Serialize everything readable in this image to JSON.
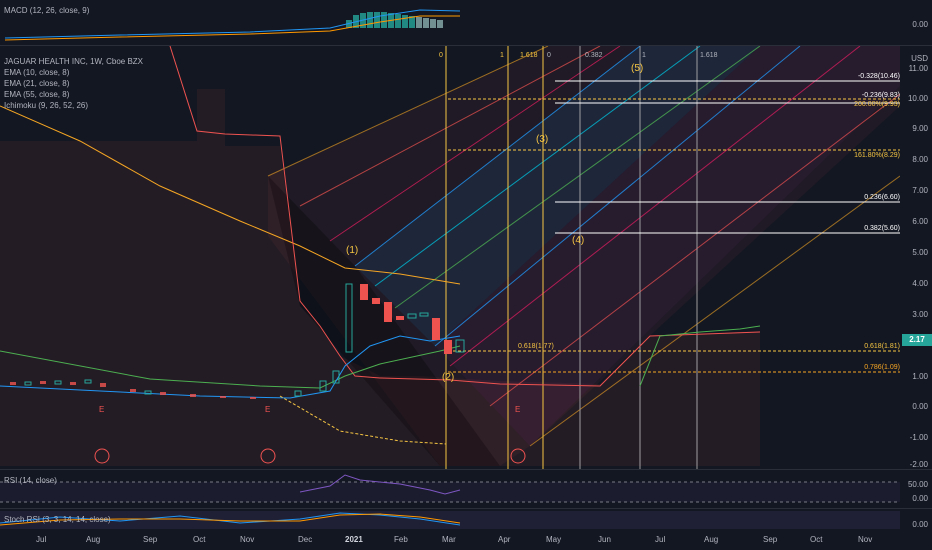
{
  "macd": {
    "legend": "MACD (12, 26, close, 9)",
    "zero": "0.00"
  },
  "main": {
    "title": "JAGUAR HEALTH INC, 1W, Cboe BZX",
    "indicators": [
      "EMA (10, close, 8)",
      "EMA (21, close, 8)",
      "EMA (55, close, 8)",
      "Ichimoku (9, 26, 52, 26)"
    ],
    "currency": "USD",
    "price_axis": [
      "11.00",
      "10.00",
      "9.00",
      "8.00",
      "7.00",
      "6.00",
      "5.00",
      "4.00",
      "3.00",
      "1.00",
      "0.00",
      "-1.00",
      "-2.00"
    ],
    "last_price": "2.17",
    "fib_top": [
      "0",
      "1",
      "1.618",
      "0",
      "0.382",
      "1",
      "1.618"
    ],
    "fib_levels": [
      {
        "text": "-0.328(10.46)",
        "color": "#ffffff"
      },
      {
        "text": "-0.236(9.83)",
        "color": "#ffffff"
      },
      {
        "text": "200.00%(9.93)",
        "color": "#f5c542"
      },
      {
        "text": "161.80%(8.29)",
        "color": "#f5c542"
      },
      {
        "text": "0.236(6.60)",
        "color": "#ffffff"
      },
      {
        "text": "0.382(5.60)",
        "color": "#ffffff"
      },
      {
        "text": "0.618(1.81)",
        "color": "#f5c542"
      },
      {
        "text": "0.786(1.09)",
        "color": "#f5a623"
      }
    ],
    "fib_left_label": "0.618(1.77)",
    "waves": [
      "(1)",
      "(2)",
      "(3)",
      "(4)",
      "(5)"
    ],
    "event_marker": "E"
  },
  "rsi": {
    "legend": "RSI (14, close)",
    "ticks": [
      "50.00",
      "0.00"
    ]
  },
  "stoch": {
    "legend": "Stoch RSI (3, 3, 14, 14, close)",
    "ticks": [
      "0.00"
    ]
  },
  "time_axis": [
    "Jul",
    "Aug",
    "Sep",
    "Oct",
    "Nov",
    "Dec",
    "2021",
    "Feb",
    "Mar",
    "Apr",
    "May",
    "Jun",
    "Jul",
    "Aug",
    "Sep",
    "Oct",
    "Nov"
  ],
  "colors": {
    "bg": "#131722",
    "up": "#26a69a",
    "down": "#ef5350",
    "fib": "#f5c542",
    "ema_orange": "#f5a623",
    "ema_blue": "#2196f3",
    "ema_green": "#4caf50"
  },
  "chart_data": {
    "type": "candlestick",
    "title": "JAGUAR HEALTH INC, 1W, Cboe BZX",
    "ylim": [
      -2,
      11
    ],
    "candles": [
      {
        "x": "2021-01-04",
        "o": 1.0,
        "c": 4.0
      },
      {
        "x": "2021-01-11",
        "o": 4.0,
        "c": 3.2
      },
      {
        "x": "2021-01-18",
        "o": 3.2,
        "c": 3.0
      },
      {
        "x": "2021-01-25",
        "o": 3.0,
        "c": 2.3
      },
      {
        "x": "2021-02-01",
        "o": 2.3,
        "c": 2.7
      },
      {
        "x": "2021-02-08",
        "o": 2.7,
        "c": 2.8
      },
      {
        "x": "2021-02-15",
        "o": 2.8,
        "c": 2.9
      },
      {
        "x": "2021-02-22",
        "o": 2.9,
        "c": 2.3
      },
      {
        "x": "2021-03-01",
        "o": 2.3,
        "c": 1.6
      },
      {
        "x": "2021-03-08",
        "o": 1.6,
        "c": 2.17
      }
    ]
  }
}
